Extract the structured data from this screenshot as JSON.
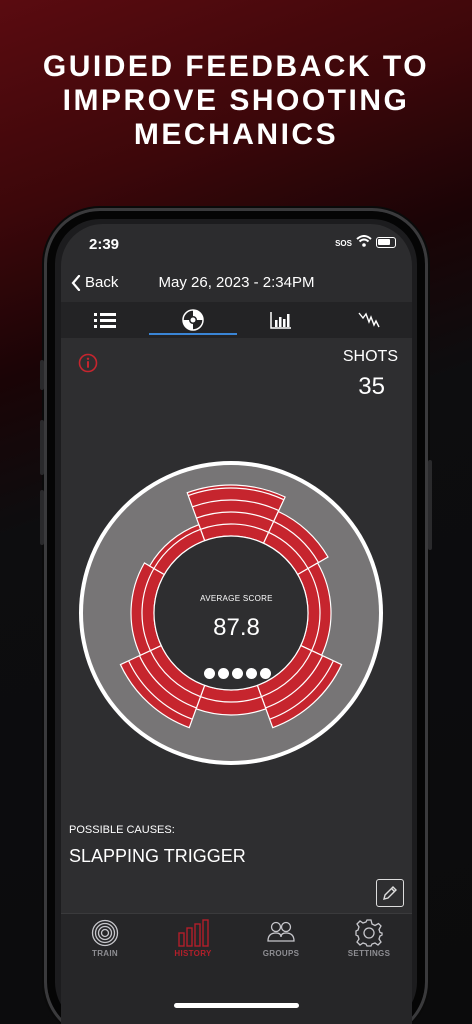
{
  "headline": {
    "line1": "GUIDED FEEDBACK TO",
    "line2": "IMPROVE SHOOTING",
    "line3": "MECHANICS"
  },
  "status_bar": {
    "time": "2:39",
    "sos": "SOS"
  },
  "navbar": {
    "back_label": "Back",
    "title": "May 26, 2023 - 2:34PM"
  },
  "top_tabs": [
    {
      "icon": "list-icon"
    },
    {
      "icon": "target-wheel-icon",
      "active": true
    },
    {
      "icon": "bar-chart-icon"
    },
    {
      "icon": "waveform-icon"
    }
  ],
  "shots": {
    "label": "SHOTS",
    "value": "35"
  },
  "wheel": {
    "average_label": "AVERAGE SCORE",
    "average_value": "87.8",
    "dot_count": 5
  },
  "causes": {
    "label": "POSSIBLE CAUSES:",
    "value": "SLAPPING TRIGGER"
  },
  "bottom_tabs": [
    {
      "label": "TRAIN",
      "icon": "target-icon"
    },
    {
      "label": "HISTORY",
      "icon": "history-bars-icon",
      "active": true
    },
    {
      "label": "GROUPS",
      "icon": "groups-icon"
    },
    {
      "label": "SETTINGS",
      "icon": "gear-icon"
    }
  ],
  "colors": {
    "accent": "#c6252e",
    "tab_indicator": "#3a85d6",
    "active_tab": "#b31f2a"
  }
}
